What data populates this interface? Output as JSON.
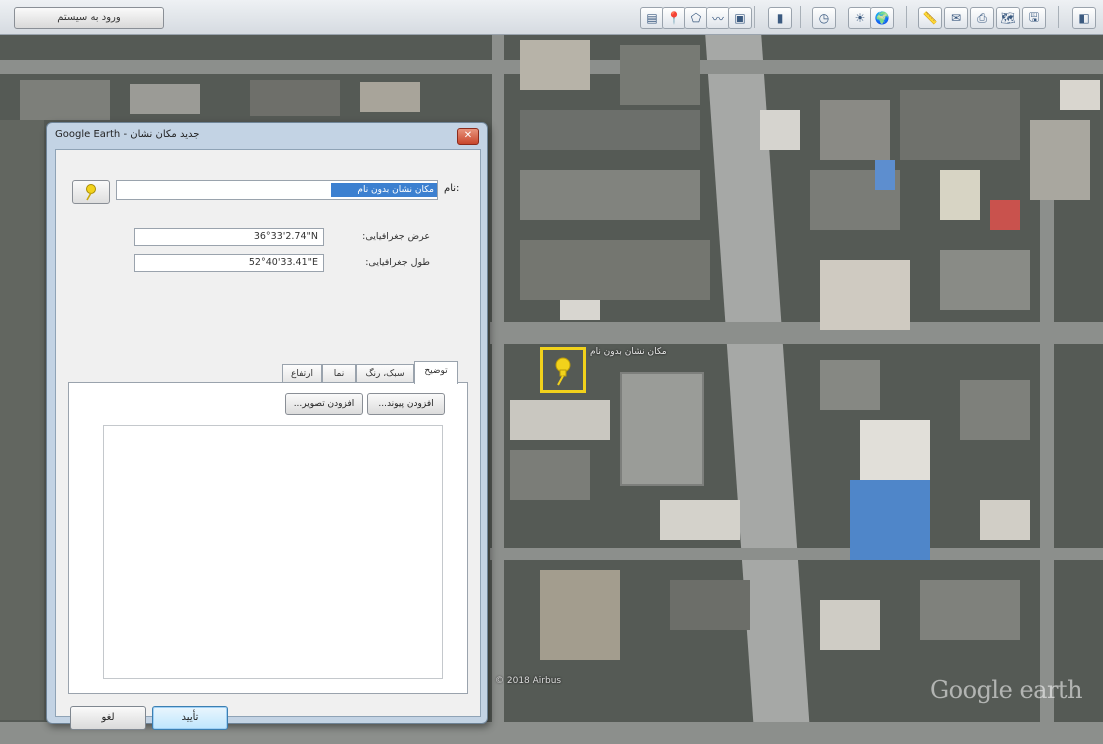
{
  "toolbar": {
    "login_label": "ورود به سیستم",
    "buttons": [
      {
        "name": "hide-sidebar-button",
        "glyph": "▤"
      },
      {
        "name": "add-placemark-button",
        "glyph": "📍"
      },
      {
        "name": "add-polygon-button",
        "glyph": "⬠"
      },
      {
        "name": "add-path-button",
        "glyph": "〰"
      },
      {
        "name": "add-image-overlay-button",
        "glyph": "▣"
      },
      {
        "name": "record-tour-button",
        "glyph": "▮"
      },
      {
        "name": "historical-imagery-button",
        "glyph": "◷"
      },
      {
        "name": "sunlight-button",
        "glyph": "☀"
      },
      {
        "name": "switch-sky-button",
        "glyph": "🌍"
      },
      {
        "name": "ruler-button",
        "glyph": "📏"
      },
      {
        "name": "email-button",
        "glyph": "✉"
      },
      {
        "name": "print-button",
        "glyph": "⎙"
      },
      {
        "name": "view-in-maps-button",
        "glyph": "🗺"
      },
      {
        "name": "save-image-button",
        "glyph": "🖫"
      },
      {
        "name": "sign-in-button",
        "glyph": "◧"
      }
    ]
  },
  "dialog": {
    "title": "Google Earth - جدید مکان نشان",
    "close_glyph": "✕",
    "name_label": "نام:",
    "name_value": "مکان نشان بدون نام",
    "latitude_label": "عرض جغرافیایی:",
    "latitude_value": "36°33'2.74\"N",
    "longitude_label": "طول جغرافیایی:",
    "longitude_value": "52°40'33.41\"E",
    "tabs": [
      "توضیح",
      "سبک، رنگ",
      "نما",
      "ارتفاع"
    ],
    "active_tab": "توضیح",
    "add_link_label": "افزودن پیوند...",
    "add_image_label": "افزودن تصویر...",
    "ok_label": "تأیید",
    "cancel_label": "لغو"
  },
  "map": {
    "place_label": "مکان نشان بدون نام",
    "copyright": "© 2018 Airbus",
    "logo": "Google earth"
  },
  "colors": {
    "marker_yellow": "#f2d21b",
    "selection_blue": "#3c80d0",
    "dialog_frame": "#c3d3e4"
  }
}
